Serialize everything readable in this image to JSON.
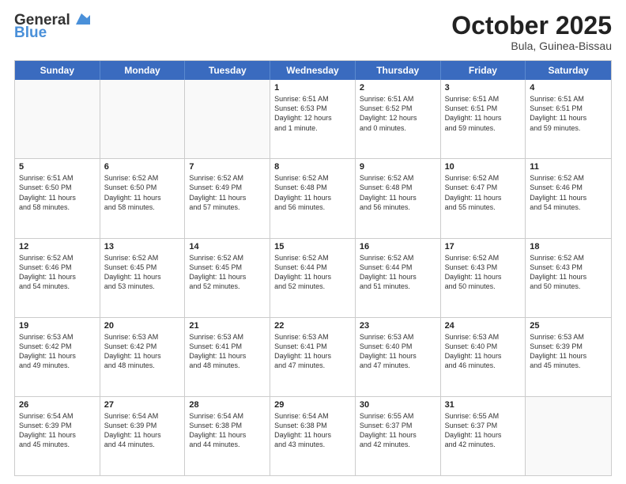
{
  "header": {
    "logo_general": "General",
    "logo_blue": "Blue",
    "month_title": "October 2025",
    "location": "Bula, Guinea-Bissau"
  },
  "weekdays": [
    "Sunday",
    "Monday",
    "Tuesday",
    "Wednesday",
    "Thursday",
    "Friday",
    "Saturday"
  ],
  "rows": [
    [
      {
        "day": "",
        "text": "",
        "empty": true
      },
      {
        "day": "",
        "text": "",
        "empty": true
      },
      {
        "day": "",
        "text": "",
        "empty": true
      },
      {
        "day": "1",
        "text": "Sunrise: 6:51 AM\nSunset: 6:53 PM\nDaylight: 12 hours\nand 1 minute.",
        "empty": false
      },
      {
        "day": "2",
        "text": "Sunrise: 6:51 AM\nSunset: 6:52 PM\nDaylight: 12 hours\nand 0 minutes.",
        "empty": false
      },
      {
        "day": "3",
        "text": "Sunrise: 6:51 AM\nSunset: 6:51 PM\nDaylight: 11 hours\nand 59 minutes.",
        "empty": false
      },
      {
        "day": "4",
        "text": "Sunrise: 6:51 AM\nSunset: 6:51 PM\nDaylight: 11 hours\nand 59 minutes.",
        "empty": false
      }
    ],
    [
      {
        "day": "5",
        "text": "Sunrise: 6:51 AM\nSunset: 6:50 PM\nDaylight: 11 hours\nand 58 minutes.",
        "empty": false
      },
      {
        "day": "6",
        "text": "Sunrise: 6:52 AM\nSunset: 6:50 PM\nDaylight: 11 hours\nand 58 minutes.",
        "empty": false
      },
      {
        "day": "7",
        "text": "Sunrise: 6:52 AM\nSunset: 6:49 PM\nDaylight: 11 hours\nand 57 minutes.",
        "empty": false
      },
      {
        "day": "8",
        "text": "Sunrise: 6:52 AM\nSunset: 6:48 PM\nDaylight: 11 hours\nand 56 minutes.",
        "empty": false
      },
      {
        "day": "9",
        "text": "Sunrise: 6:52 AM\nSunset: 6:48 PM\nDaylight: 11 hours\nand 56 minutes.",
        "empty": false
      },
      {
        "day": "10",
        "text": "Sunrise: 6:52 AM\nSunset: 6:47 PM\nDaylight: 11 hours\nand 55 minutes.",
        "empty": false
      },
      {
        "day": "11",
        "text": "Sunrise: 6:52 AM\nSunset: 6:46 PM\nDaylight: 11 hours\nand 54 minutes.",
        "empty": false
      }
    ],
    [
      {
        "day": "12",
        "text": "Sunrise: 6:52 AM\nSunset: 6:46 PM\nDaylight: 11 hours\nand 54 minutes.",
        "empty": false
      },
      {
        "day": "13",
        "text": "Sunrise: 6:52 AM\nSunset: 6:45 PM\nDaylight: 11 hours\nand 53 minutes.",
        "empty": false
      },
      {
        "day": "14",
        "text": "Sunrise: 6:52 AM\nSunset: 6:45 PM\nDaylight: 11 hours\nand 52 minutes.",
        "empty": false
      },
      {
        "day": "15",
        "text": "Sunrise: 6:52 AM\nSunset: 6:44 PM\nDaylight: 11 hours\nand 52 minutes.",
        "empty": false
      },
      {
        "day": "16",
        "text": "Sunrise: 6:52 AM\nSunset: 6:44 PM\nDaylight: 11 hours\nand 51 minutes.",
        "empty": false
      },
      {
        "day": "17",
        "text": "Sunrise: 6:52 AM\nSunset: 6:43 PM\nDaylight: 11 hours\nand 50 minutes.",
        "empty": false
      },
      {
        "day": "18",
        "text": "Sunrise: 6:52 AM\nSunset: 6:43 PM\nDaylight: 11 hours\nand 50 minutes.",
        "empty": false
      }
    ],
    [
      {
        "day": "19",
        "text": "Sunrise: 6:53 AM\nSunset: 6:42 PM\nDaylight: 11 hours\nand 49 minutes.",
        "empty": false
      },
      {
        "day": "20",
        "text": "Sunrise: 6:53 AM\nSunset: 6:42 PM\nDaylight: 11 hours\nand 48 minutes.",
        "empty": false
      },
      {
        "day": "21",
        "text": "Sunrise: 6:53 AM\nSunset: 6:41 PM\nDaylight: 11 hours\nand 48 minutes.",
        "empty": false
      },
      {
        "day": "22",
        "text": "Sunrise: 6:53 AM\nSunset: 6:41 PM\nDaylight: 11 hours\nand 47 minutes.",
        "empty": false
      },
      {
        "day": "23",
        "text": "Sunrise: 6:53 AM\nSunset: 6:40 PM\nDaylight: 11 hours\nand 47 minutes.",
        "empty": false
      },
      {
        "day": "24",
        "text": "Sunrise: 6:53 AM\nSunset: 6:40 PM\nDaylight: 11 hours\nand 46 minutes.",
        "empty": false
      },
      {
        "day": "25",
        "text": "Sunrise: 6:53 AM\nSunset: 6:39 PM\nDaylight: 11 hours\nand 45 minutes.",
        "empty": false
      }
    ],
    [
      {
        "day": "26",
        "text": "Sunrise: 6:54 AM\nSunset: 6:39 PM\nDaylight: 11 hours\nand 45 minutes.",
        "empty": false
      },
      {
        "day": "27",
        "text": "Sunrise: 6:54 AM\nSunset: 6:39 PM\nDaylight: 11 hours\nand 44 minutes.",
        "empty": false
      },
      {
        "day": "28",
        "text": "Sunrise: 6:54 AM\nSunset: 6:38 PM\nDaylight: 11 hours\nand 44 minutes.",
        "empty": false
      },
      {
        "day": "29",
        "text": "Sunrise: 6:54 AM\nSunset: 6:38 PM\nDaylight: 11 hours\nand 43 minutes.",
        "empty": false
      },
      {
        "day": "30",
        "text": "Sunrise: 6:55 AM\nSunset: 6:37 PM\nDaylight: 11 hours\nand 42 minutes.",
        "empty": false
      },
      {
        "day": "31",
        "text": "Sunrise: 6:55 AM\nSunset: 6:37 PM\nDaylight: 11 hours\nand 42 minutes.",
        "empty": false
      },
      {
        "day": "",
        "text": "",
        "empty": true
      }
    ]
  ]
}
